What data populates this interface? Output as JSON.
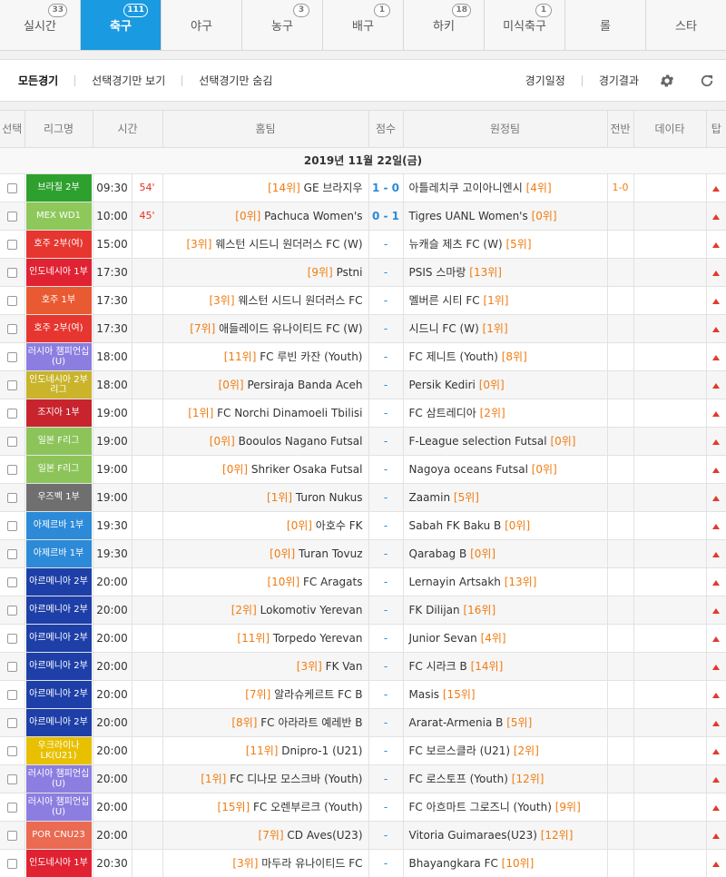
{
  "tabs": [
    {
      "label": "실시간",
      "count": "33",
      "active": false
    },
    {
      "label": "축구",
      "count": "111",
      "active": true
    },
    {
      "label": "야구",
      "count": "",
      "active": false
    },
    {
      "label": "농구",
      "count": "3",
      "active": false
    },
    {
      "label": "배구",
      "count": "1",
      "active": false
    },
    {
      "label": "하키",
      "count": "18",
      "active": false
    },
    {
      "label": "미식축구",
      "count": "1",
      "active": false
    },
    {
      "label": "롤",
      "count": "",
      "active": false
    },
    {
      "label": "스타",
      "count": "",
      "active": false
    }
  ],
  "filter": {
    "all": "모든경기",
    "show_selected": "선택경기만 보기",
    "hide_selected": "선택경기만 숨김",
    "schedule": "경기일정",
    "results": "경기결과",
    "settings_icon": "gear-icon",
    "refresh_icon": "refresh-icon"
  },
  "table": {
    "headers": [
      "선택",
      "리그명",
      "시간",
      "홈팀",
      "점수",
      "원정팀",
      "전반",
      "데이타",
      "탑"
    ],
    "date": "2019년 11월 22일(금)",
    "rows": [
      {
        "league": "브라질 2부",
        "color": "#2ea02e",
        "time": "09:30",
        "minute": "54'",
        "home_rank": "[14위]",
        "home": "GE 브라지우",
        "score": "1 - 0",
        "away": "아틀레치쿠 고이아니엔시",
        "away_rank": "[4위]",
        "half": "1-0"
      },
      {
        "league": "MEX WD1",
        "color": "#8ec85a",
        "time": "10:00",
        "minute": "45'",
        "home_rank": "[0위]",
        "home": "Pachuca Women's",
        "score": "0 - 1",
        "away": "Tigres UANL Women's",
        "away_rank": "[0위]",
        "half": ""
      },
      {
        "league": "호주 2부(여)",
        "color": "#e6362f",
        "time": "15:00",
        "minute": "",
        "home_rank": "[3위]",
        "home": "웨스턴 시드니 원더러스 FC (W)",
        "score": "-",
        "away": "뉴캐슬 제츠 FC (W)",
        "away_rank": "[5위]",
        "half": ""
      },
      {
        "league": "인도네시아 1부",
        "color": "#e02233",
        "time": "17:30",
        "minute": "",
        "home_rank": "[9위]",
        "home": "Pstni",
        "score": "-",
        "away": "PSIS 스마랑",
        "away_rank": "[13위]",
        "half": ""
      },
      {
        "league": "호주 1부",
        "color": "#ea5a32",
        "time": "17:30",
        "minute": "",
        "home_rank": "[3위]",
        "home": "웨스턴 시드니 원더러스 FC",
        "score": "-",
        "away": "멜버른 시티 FC",
        "away_rank": "[1위]",
        "half": ""
      },
      {
        "league": "호주 2부(여)",
        "color": "#e6362f",
        "time": "17:30",
        "minute": "",
        "home_rank": "[7위]",
        "home": "애들레이드 유나이티드 FC (W)",
        "score": "-",
        "away": "시드니 FC (W)",
        "away_rank": "[1위]",
        "half": ""
      },
      {
        "league": "러시아 챔피언십(U)",
        "color": "#8c7ee0",
        "time": "18:00",
        "minute": "",
        "home_rank": "[11위]",
        "home": "FC 루빈 카잔 (Youth)",
        "score": "-",
        "away": "FC 제니트 (Youth)",
        "away_rank": "[8위]",
        "half": ""
      },
      {
        "league": "인도네시아 2부리그",
        "color": "#c9b42a",
        "time": "18:00",
        "minute": "",
        "home_rank": "[0위]",
        "home": "Persiraja Banda Aceh",
        "score": "-",
        "away": "Persik Kediri",
        "away_rank": "[0위]",
        "half": ""
      },
      {
        "league": "조지아 1부",
        "color": "#c8242e",
        "time": "19:00",
        "minute": "",
        "home_rank": "[1위]",
        "home": "FC Norchi Dinamoeli Tbilisi",
        "score": "-",
        "away": "FC 삼트레디아",
        "away_rank": "[2위]",
        "half": ""
      },
      {
        "league": "일본 F리그",
        "color": "#8cc45a",
        "time": "19:00",
        "minute": "",
        "home_rank": "[0위]",
        "home": "Booulos Nagano Futsal",
        "score": "-",
        "away": "F-League selection Futsal",
        "away_rank": "[0위]",
        "half": ""
      },
      {
        "league": "일본 F리그",
        "color": "#8cc45a",
        "time": "19:00",
        "minute": "",
        "home_rank": "[0위]",
        "home": "Shriker Osaka Futsal",
        "score": "-",
        "away": "Nagoya oceans Futsal",
        "away_rank": "[0위]",
        "half": ""
      },
      {
        "league": "우즈벡 1부",
        "color": "#6f6f6f",
        "time": "19:00",
        "minute": "",
        "home_rank": "[1위]",
        "home": "Turon Nukus",
        "score": "-",
        "away": "Zaamin",
        "away_rank": "[5위]",
        "half": ""
      },
      {
        "league": "아제르바 1부",
        "color": "#2c8ad8",
        "time": "19:30",
        "minute": "",
        "home_rank": "[0위]",
        "home": "아호수 FK",
        "score": "-",
        "away": "Sabah FK Baku B",
        "away_rank": "[0위]",
        "half": ""
      },
      {
        "league": "아제르바 1부",
        "color": "#2c8ad8",
        "time": "19:30",
        "minute": "",
        "home_rank": "[0위]",
        "home": "Turan Tovuz",
        "score": "-",
        "away": "Qarabag B",
        "away_rank": "[0위]",
        "half": ""
      },
      {
        "league": "아르메니아 2부",
        "color": "#1e3fa8",
        "time": "20:00",
        "minute": "",
        "home_rank": "[10위]",
        "home": "FC Aragats",
        "score": "-",
        "away": "Lernayin Artsakh",
        "away_rank": "[13위]",
        "half": ""
      },
      {
        "league": "아르메니아 2부",
        "color": "#1e3fa8",
        "time": "20:00",
        "minute": "",
        "home_rank": "[2위]",
        "home": "Lokomotiv Yerevan",
        "score": "-",
        "away": "FK Dilijan",
        "away_rank": "[16위]",
        "half": ""
      },
      {
        "league": "아르메니아 2부",
        "color": "#1e3fa8",
        "time": "20:00",
        "minute": "",
        "home_rank": "[11위]",
        "home": "Torpedo Yerevan",
        "score": "-",
        "away": "Junior Sevan",
        "away_rank": "[4위]",
        "half": ""
      },
      {
        "league": "아르메니아 2부",
        "color": "#1e3fa8",
        "time": "20:00",
        "minute": "",
        "home_rank": "[3위]",
        "home": "FK Van",
        "score": "-",
        "away": "FC 시라크 B",
        "away_rank": "[14위]",
        "half": ""
      },
      {
        "league": "아르메니아 2부",
        "color": "#1e3fa8",
        "time": "20:00",
        "minute": "",
        "home_rank": "[7위]",
        "home": "알라슈케르트 FC B",
        "score": "-",
        "away": "Masis",
        "away_rank": "[15위]",
        "half": ""
      },
      {
        "league": "아르메니아 2부",
        "color": "#1e3fa8",
        "time": "20:00",
        "minute": "",
        "home_rank": "[8위]",
        "home": "FC 아라라트 예레반 B",
        "score": "-",
        "away": "Ararat-Armenia B",
        "away_rank": "[5위]",
        "half": ""
      },
      {
        "league": "우크라이나LK(U21)",
        "color": "#e8c000",
        "time": "20:00",
        "minute": "",
        "home_rank": "[11위]",
        "home": "Dnipro-1 (U21)",
        "score": "-",
        "away": "FC 보르스클라 (U21)",
        "away_rank": "[2위]",
        "half": ""
      },
      {
        "league": "러시아 챔피언십(U)",
        "color": "#8c7ee0",
        "time": "20:00",
        "minute": "",
        "home_rank": "[1위]",
        "home": "FC 디나모 모스크바 (Youth)",
        "score": "-",
        "away": "FC 로스토프 (Youth)",
        "away_rank": "[12위]",
        "half": ""
      },
      {
        "league": "러시아 챔피언십(U)",
        "color": "#8c7ee0",
        "time": "20:00",
        "minute": "",
        "home_rank": "[15위]",
        "home": "FC 오렌부르크 (Youth)",
        "score": "-",
        "away": "FC 아흐마트 그로즈니 (Youth)",
        "away_rank": "[9위]",
        "half": ""
      },
      {
        "league": "POR CNU23",
        "color": "#ea6a52",
        "time": "20:00",
        "minute": "",
        "home_rank": "[7위]",
        "home": "CD Aves(U23)",
        "score": "-",
        "away": "Vitoria Guimaraes(U23)",
        "away_rank": "[12위]",
        "half": ""
      },
      {
        "league": "인도네시아 1부",
        "color": "#e02233",
        "time": "20:30",
        "minute": "",
        "home_rank": "[3위]",
        "home": "마두라 유나이티드 FC",
        "score": "-",
        "away": "Bhayangkara FC",
        "away_rank": "[10위]",
        "half": ""
      }
    ]
  }
}
